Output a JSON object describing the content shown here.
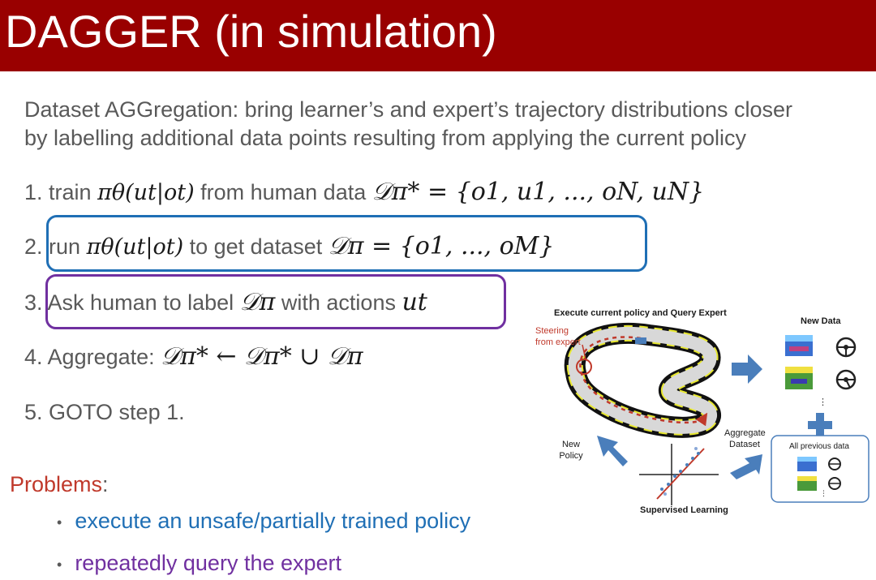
{
  "header": {
    "title": "DAGGER (in simulation)"
  },
  "intro": {
    "line1": "Dataset AGGregation: bring learner’s and expert’s trajectory distributions closer",
    "line2": "by labelling additional data points resulting from applying the current policy"
  },
  "steps": [
    {
      "num": "1.",
      "prefix": "train",
      "math1": "πθ(ut|ot)",
      "middle": "from human data",
      "math2": "𝒟π* = {o1, u1, ..., oN, uN}"
    },
    {
      "num": "2.",
      "prefix": "run",
      "math1": "πθ(ut|ot)",
      "middle": "to get dataset",
      "math2": "𝒟π = {o1, ..., oM}"
    },
    {
      "num": "3.",
      "prefix": "Ask human to label",
      "math1": "𝒟π",
      "middle": "with actions",
      "math2": "ut"
    },
    {
      "num": "4.",
      "prefix": "Aggregate:",
      "math1": "𝒟π* ← 𝒟π* ∪ 𝒟π"
    },
    {
      "num": "5.",
      "prefix": "GOTO step 1."
    }
  ],
  "problems": {
    "label": "Problems",
    "colon": ":",
    "bullets": [
      "execute an unsafe/partially trained policy",
      "repeatedly query the expert"
    ]
  },
  "diagram": {
    "execute_label": "Execute current policy and Query Expert",
    "steering_line1": "Steering",
    "steering_line2": "from expert",
    "new_data_label": "New Data",
    "aggregate_line1": "Aggregate",
    "aggregate_line2": "Dataset",
    "all_previous_label": "All previous data",
    "new_policy_line1": "New",
    "new_policy_line2": "Policy",
    "supervised_label": "Supervised Learning",
    "ellipsis": "⋮"
  },
  "colors": {
    "title_bar": "#990000",
    "blue": "#1f6fb5",
    "purple": "#7030a0",
    "problems_red": "#c0392b",
    "arrow_blue": "#4a7ebb"
  }
}
